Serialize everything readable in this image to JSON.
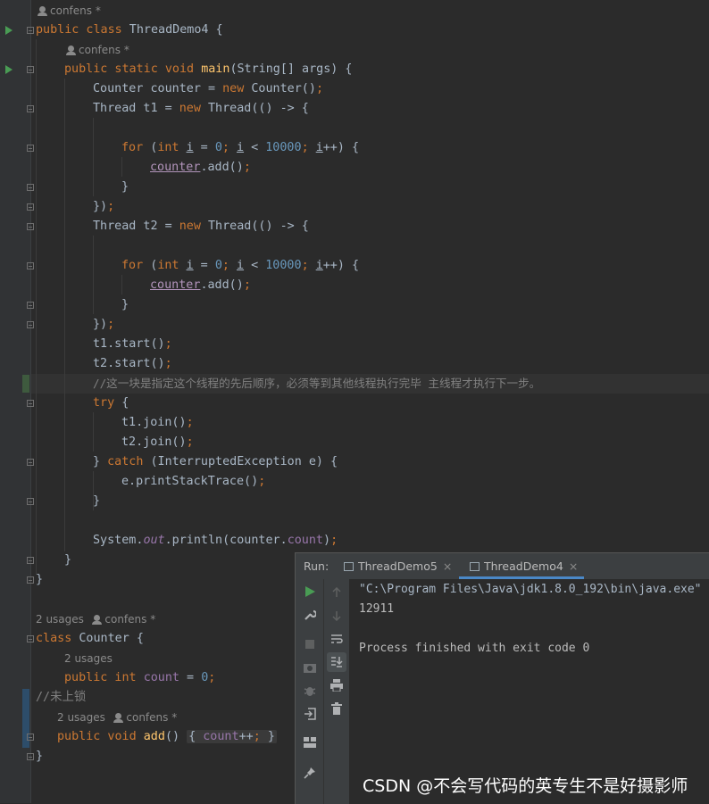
{
  "editor": {
    "hints": {
      "h1": "confens *",
      "h2": "confens *",
      "h3_usages": "2 usages",
      "h3_author": "confens *",
      "h4_usages": "2 usages",
      "h5_usages": "2 usages",
      "h5_author": "confens *"
    },
    "lines": {
      "l1_kw": "public class",
      "l1_rest": " ThreadDemo4 {",
      "l2_kw": "public static void",
      "l2_fn": "main",
      "l2_rest": "(String[] args) {",
      "l3_a": "Counter counter = ",
      "l3_new": "new",
      "l3_b": " Counter()",
      "l3_semi": ";",
      "l4_a": "Thread t1 = ",
      "l4_new": "new",
      "l4_b": " Thread(() -> {",
      "for_kw": "for",
      "for_int": "int",
      "for_i": "i",
      "for_eq": " = ",
      "for_zero": "0",
      "for_lt": " < ",
      "for_max": "10000",
      "for_inc": "++) {",
      "counter_var": "counter",
      "add_call": ".add()",
      "semi": ";",
      "close_brace": "}",
      "close_lambda": "})",
      "l8_a": "Thread t2 = ",
      "l8_new": "new",
      "l8_b": " Thread(() -> {",
      "t1_start": "t1.start()",
      "t2_start": "t2.start()",
      "comment": "//这一块是指定这个线程的先后顺序，必须等到其他线程执行完毕 主线程才执行下一步。",
      "try_kw": "try",
      "try_rest": " {",
      "t1_join": "t1.join()",
      "t2_join": "t2.join()",
      "catch_a": "} ",
      "catch_kw": "catch",
      "catch_rest": " (InterruptedException e) {",
      "print_trace": "e.printStackTrace()",
      "sys_a": "System.",
      "sys_out": "out",
      "sys_b": ".println(counter.",
      "sys_count": "count",
      "sys_c": ")",
      "class_kw": "class",
      "class_rest": " Counter {",
      "field_kw": "public int",
      "field_name": "count",
      "field_eq": " = ",
      "field_val": "0",
      "comment2": "//未上锁",
      "add_kw": "public void",
      "add_fn": "add",
      "add_paren": "()",
      "add_body_open": "{",
      "add_body_count": "count",
      "add_body_inc": "++",
      "add_body_close": "}"
    }
  },
  "run_panel": {
    "label": "Run:",
    "tabs": [
      {
        "label": "ThreadDemo5"
      },
      {
        "label": "ThreadDemo4"
      }
    ],
    "close_glyph": "×",
    "console": [
      "\"C:\\Program Files\\Java\\jdk1.8.0_192\\bin\\java.exe\"",
      "12911",
      "",
      "Process finished with exit code 0"
    ]
  },
  "watermark": "CSDN @不会写代码的英专生不是好摄影师",
  "colors": {
    "background": "#2b2b2b",
    "keyword": "#cc7832",
    "number": "#6897bb",
    "method": "#ffc66d",
    "field": "#9876aa",
    "comment": "#808080",
    "run_green": "#499c54",
    "tab_accent": "#4a88c7"
  },
  "icons": [
    "run-icon",
    "wrench-icon",
    "stop-icon",
    "camera-icon",
    "bug-icon",
    "login-icon",
    "layout-icon",
    "pin-icon",
    "up-arrow-icon",
    "down-arrow-icon",
    "soft-wrap-icon",
    "scroll-end-icon",
    "print-icon",
    "trash-icon",
    "fold-icon"
  ]
}
